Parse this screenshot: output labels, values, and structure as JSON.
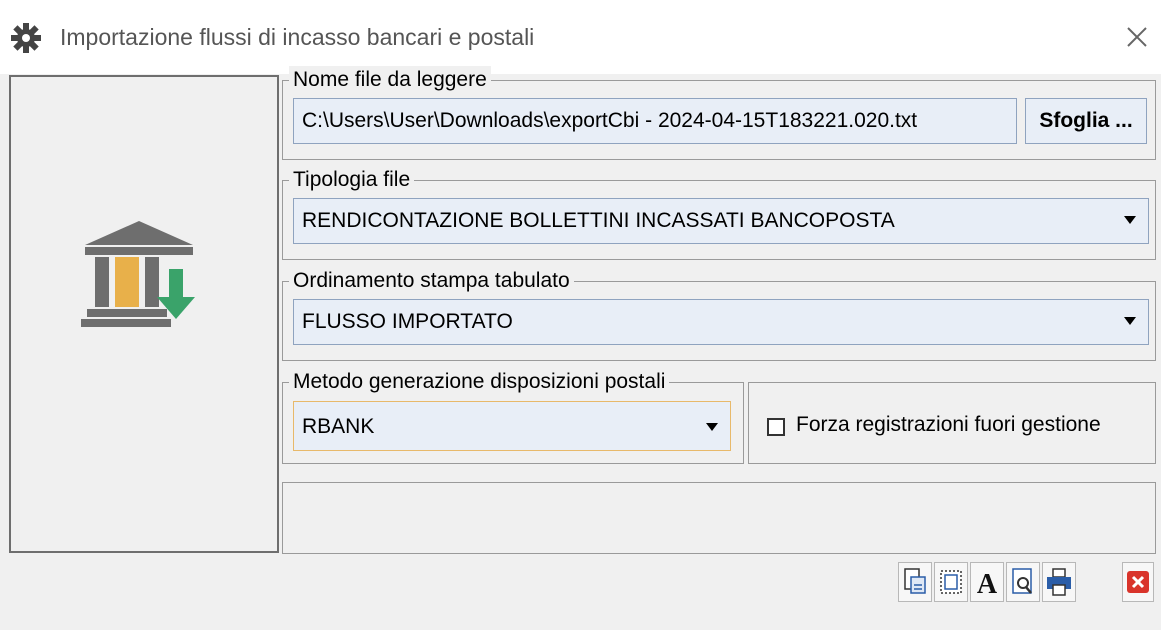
{
  "window": {
    "title": "Importazione flussi di incasso bancari e postali"
  },
  "file_group": {
    "legend": "Nome file da leggere",
    "path_value": "C:\\Users\\User\\Downloads\\exportCbi - 2024-04-15T183221.020.txt",
    "browse_label": "Sfoglia ..."
  },
  "type_group": {
    "legend": "Tipologia file",
    "selected": "RENDICONTAZIONE BOLLETTINI INCASSATI BANCOPOSTA"
  },
  "order_group": {
    "legend": "Ordinamento stampa tabulato",
    "selected": "FLUSSO IMPORTATO"
  },
  "method_group": {
    "legend": "Metodo generazione disposizioni postali",
    "selected": "RBANK"
  },
  "force_option": {
    "label": "Forza registrazioni fuori gestione",
    "checked": false
  },
  "colors": {
    "window_bg": "#f0f0f0",
    "field_bg": "#e8eef7",
    "focus_border": "#e8b96a",
    "bank_gray": "#6e6e6e",
    "bank_orange": "#e8b04a",
    "arrow_green": "#3aa36a",
    "close_red": "#d9342b"
  },
  "toolbar": {
    "icons": [
      "export-icon",
      "select-area-icon",
      "font-icon",
      "preview-icon",
      "print-icon",
      "close-red-icon"
    ]
  }
}
